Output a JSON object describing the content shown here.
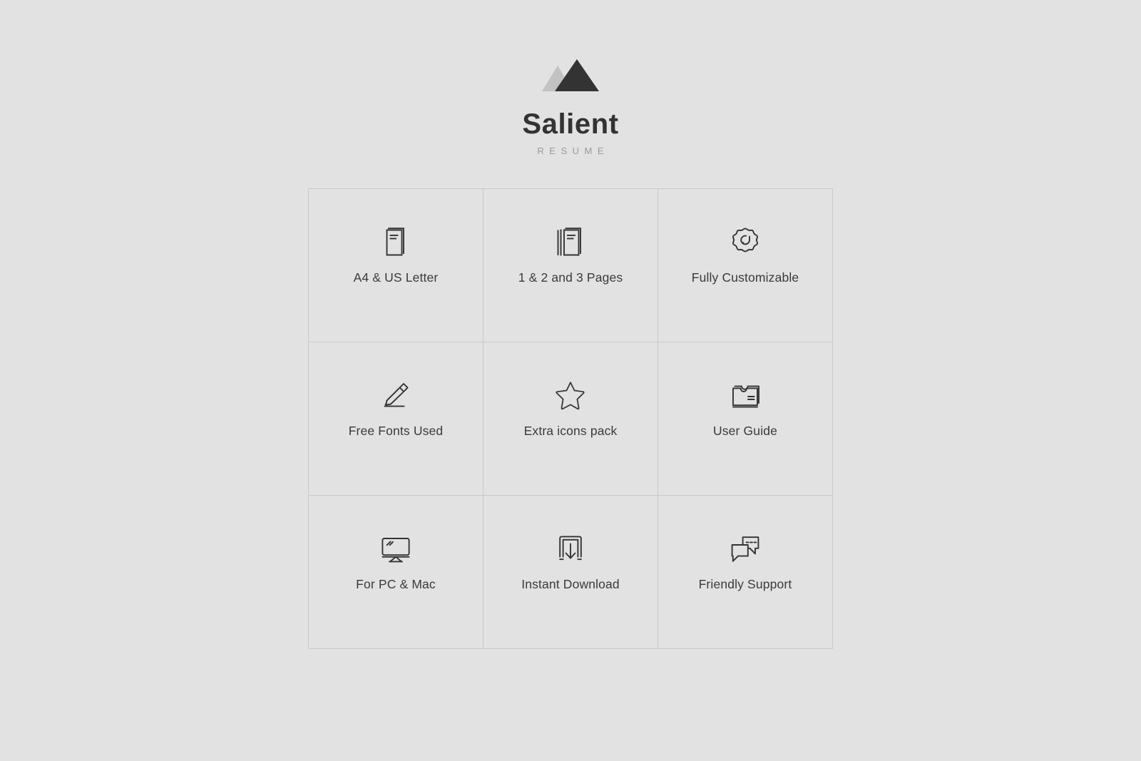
{
  "brand": {
    "name": "Salient",
    "subtitle": "RESUME",
    "logo_icon": "mountain-peaks-icon",
    "logo_dark_color": "#333333",
    "logo_light_color": "#c2c2c2"
  },
  "theme": {
    "background": "#e2e2e2",
    "grid_line": "#c9c9c9",
    "icon_stroke": "#333333",
    "label_color": "#3a3a3a",
    "subtitle_color": "#9a9a9a"
  },
  "features": [
    {
      "label": "A4 & US Letter",
      "icon": "document-page-icon"
    },
    {
      "label": "1 & 2 and 3 Pages",
      "icon": "stacked-pages-icon"
    },
    {
      "label": "Fully Customizable",
      "icon": "gear-icon"
    },
    {
      "label": "Free Fonts Used",
      "icon": "pencil-icon"
    },
    {
      "label": "Extra icons pack",
      "icon": "star-icon"
    },
    {
      "label": "User Guide",
      "icon": "folder-document-icon"
    },
    {
      "label": "For PC & Mac",
      "icon": "monitor-icon"
    },
    {
      "label": "Instant Download",
      "icon": "download-tray-icon"
    },
    {
      "label": "Friendly Support",
      "icon": "chat-bubbles-icon"
    }
  ]
}
